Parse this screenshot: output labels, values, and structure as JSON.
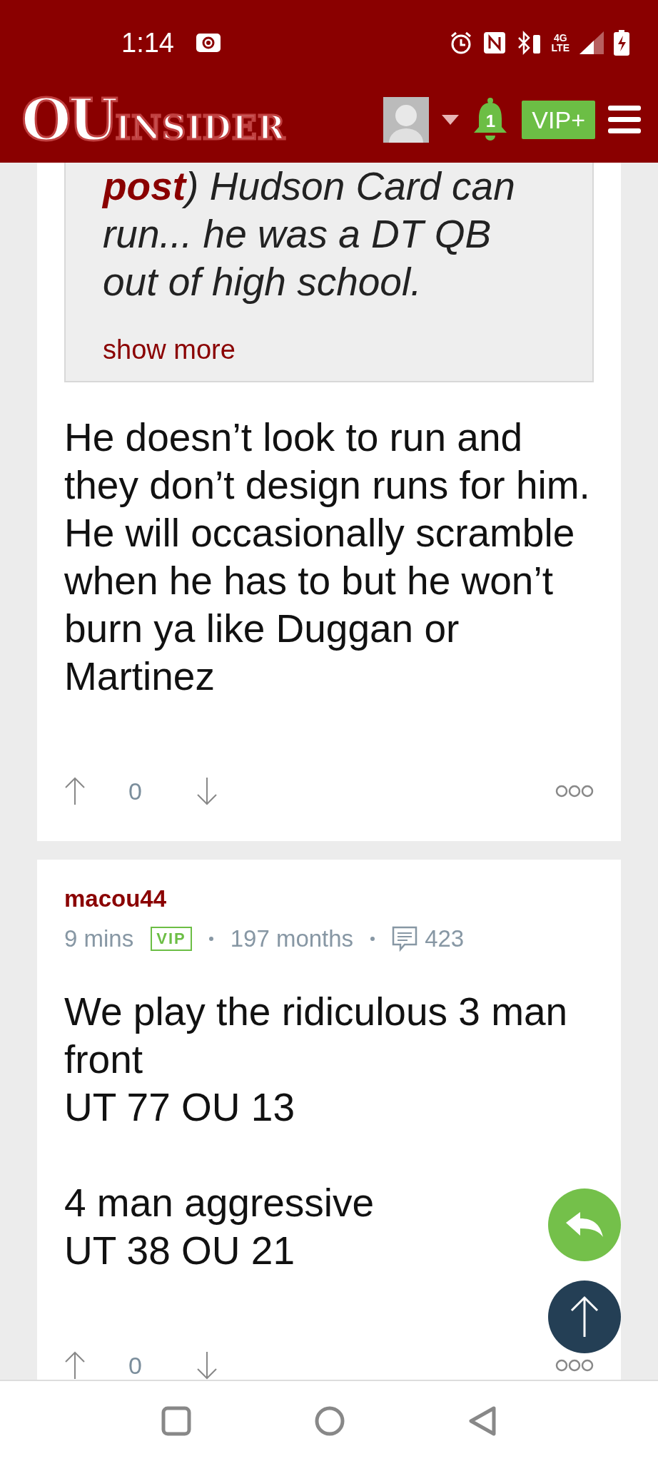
{
  "status_bar": {
    "time": "1:14",
    "network": "4G\nLTE"
  },
  "header": {
    "logo_big": "OU",
    "logo_small": "INSIDER",
    "notifications": "1",
    "vip_button": "VIP+"
  },
  "posts": [
    {
      "quote": {
        "text": "**post**) Hudson Card can run... he was a DT QB out of high school.",
        "show_more": "show more"
      },
      "paragraphs": [
        "He doesn’t look to run and they don’t design runs for him. He will occasionally scramble when he has to but he won’t burn ya like Duggan or Martinez"
      ],
      "votes": "0"
    },
    {
      "author": "macou44",
      "time": "9 mins",
      "badge": "VIP",
      "tenure": "197 months",
      "post_count": "423",
      "paragraphs": [
        "We play the ridiculous 3 man front\nUT 77 OU 13",
        "4 man aggressive\nUT 38 OU 21"
      ],
      "votes": "0"
    }
  ]
}
